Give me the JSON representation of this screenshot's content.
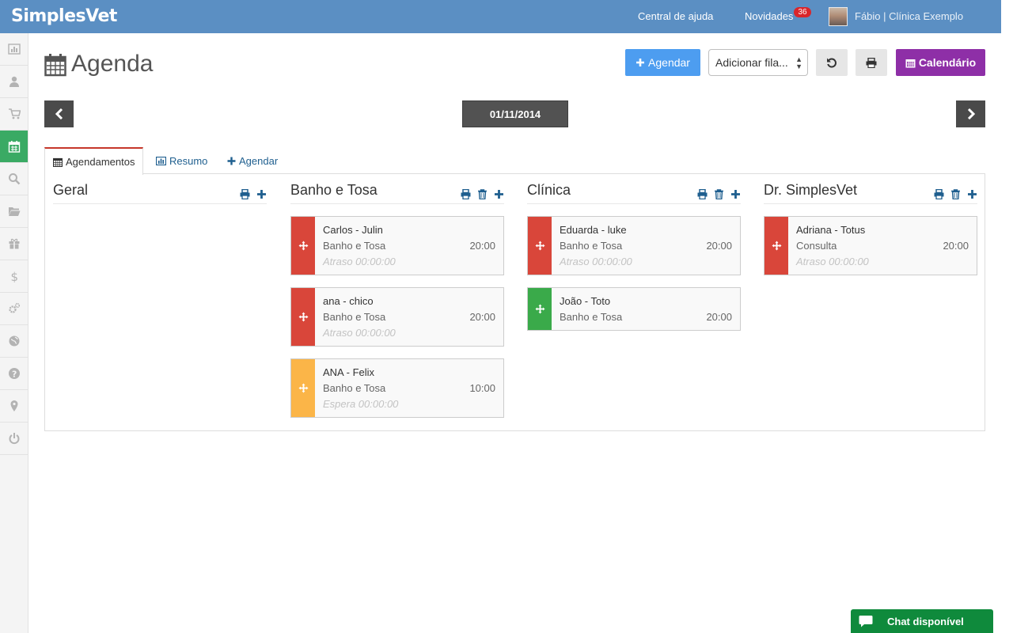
{
  "header": {
    "logo": "SimplesVet",
    "help_link": "Central de ajuda",
    "news_link": "Novidades",
    "news_badge": "36",
    "user_label": "Fábio | Clínica Exemplo"
  },
  "sidebar": {
    "items": [
      {
        "icon": "bar-chart-icon"
      },
      {
        "icon": "user-icon"
      },
      {
        "icon": "shopping-cart-icon"
      },
      {
        "icon": "calendar-icon",
        "active": true
      },
      {
        "icon": "search-icon"
      },
      {
        "icon": "folder-open-icon"
      },
      {
        "icon": "gift-icon"
      },
      {
        "icon": "dollar-icon"
      },
      {
        "icon": "cogs-icon"
      },
      {
        "icon": "globe-icon"
      },
      {
        "icon": "question-icon"
      },
      {
        "icon": "map-marker-icon"
      },
      {
        "icon": "power-icon"
      }
    ]
  },
  "page": {
    "title": "Agenda",
    "agendar_button": "Agendar",
    "queue_select": "Adicionar fila...",
    "calendar_button": "Calendário",
    "date": "01/11/2014"
  },
  "tabs": [
    {
      "label": "Agendamentos",
      "icon": "calendar-icon"
    },
    {
      "label": "Resumo",
      "icon": "bar-chart-icon"
    },
    {
      "label": "Agendar",
      "icon": "plus-icon"
    }
  ],
  "columns": [
    {
      "title": "Geral",
      "cards": []
    },
    {
      "title": "Banho e Tosa",
      "cards": [
        {
          "name": "Carlos - Julin",
          "service": "Banho e Tosa",
          "time": "20:00",
          "status": "Atraso 00:00:00",
          "color": "#d9463a"
        },
        {
          "name": "ana - chico",
          "service": "Banho e Tosa",
          "time": "20:00",
          "status": "Atraso 00:00:00",
          "color": "#d9463a"
        },
        {
          "name": "ANA - Felix",
          "service": "Banho e Tosa",
          "time": "10:00",
          "status": "Espera 00:00:00",
          "color": "#fbb548"
        }
      ]
    },
    {
      "title": "Clínica",
      "cards": [
        {
          "name": "Eduarda - luke",
          "service": "Banho e Tosa",
          "time": "20:00",
          "status": "Atraso 00:00:00",
          "color": "#d9463a"
        },
        {
          "name": "João - Toto",
          "service": "Banho e Tosa",
          "time": "20:00",
          "status": "",
          "color": "#3aaa4a"
        }
      ]
    },
    {
      "title": "Dr. SimplesVet",
      "cards": [
        {
          "name": "Adriana - Totus",
          "service": "Consulta",
          "time": "20:00",
          "status": "Atraso 00:00:00",
          "color": "#d9463a"
        }
      ]
    }
  ],
  "chat": {
    "label": "Chat disponível"
  }
}
